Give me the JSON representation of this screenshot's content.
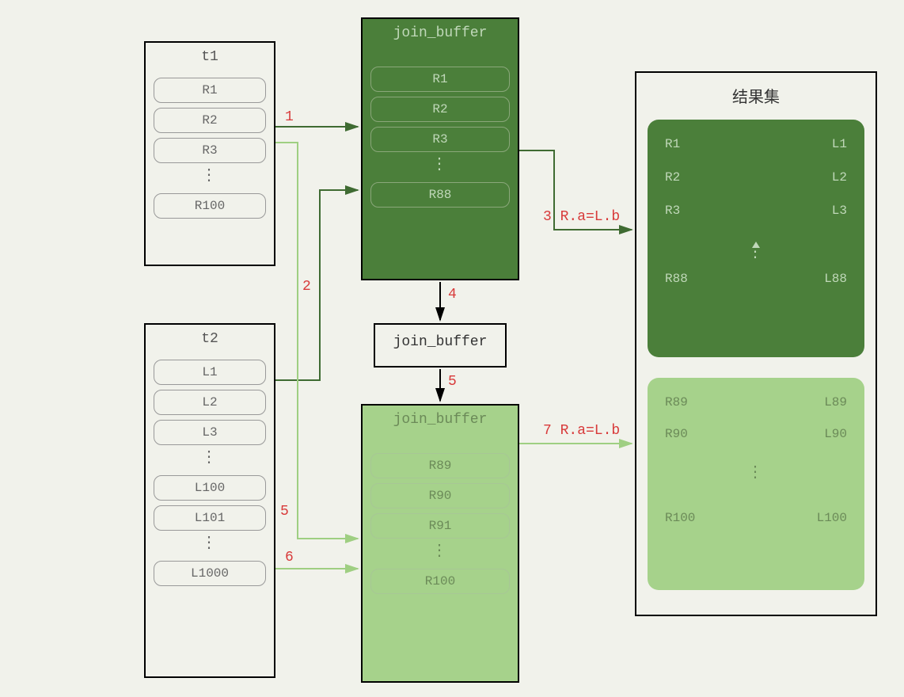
{
  "t1": {
    "title": "t1",
    "rows": [
      "R1",
      "R2",
      "R3"
    ],
    "ellipsis": "⋮",
    "last": "R100"
  },
  "t2": {
    "title": "t2",
    "rows_top": [
      "L1",
      "L2",
      "L3"
    ],
    "ellipsis": "⋮",
    "rows_mid": [
      "L100",
      "L101"
    ],
    "last": "L1000"
  },
  "jb1": {
    "title": "join_buffer",
    "rows": [
      "R1",
      "R2",
      "R3"
    ],
    "ellipsis": "⋮",
    "last": "R88"
  },
  "jb2": {
    "title": "join_buffer"
  },
  "jb3": {
    "title": "join_buffer",
    "rows": [
      "R89",
      "R90",
      "R91"
    ],
    "ellipsis": "⋮",
    "last": "R100"
  },
  "result": {
    "title": "结果集",
    "panel1": {
      "rows": [
        {
          "l": "R1",
          "r": "L1"
        },
        {
          "l": "R2",
          "r": "L2"
        },
        {
          "l": "R3",
          "r": "L3"
        }
      ],
      "ellipsis": "⋮",
      "last": {
        "l": "R88",
        "r": "L88"
      }
    },
    "panel2": {
      "rows": [
        {
          "l": "R89",
          "r": "L89"
        },
        {
          "l": "R90",
          "r": "L90"
        }
      ],
      "ellipsis": "⋮",
      "last": {
        "l": "R100",
        "r": "L100"
      }
    }
  },
  "edges": {
    "e1": "1",
    "e2": "2",
    "e3": "3 R.a=L.b",
    "e4": "4",
    "e5a": "5",
    "e5b": "5",
    "e6": "6",
    "e7": "7 R.a=L.b"
  },
  "colors": {
    "dark_green": "#4b7f3a",
    "light_green": "#a6d28b",
    "edge_dark": "#3f6b32",
    "edge_light": "#9fcf82",
    "label_red": "#d83a3a",
    "bg": "#f1f2eb"
  }
}
